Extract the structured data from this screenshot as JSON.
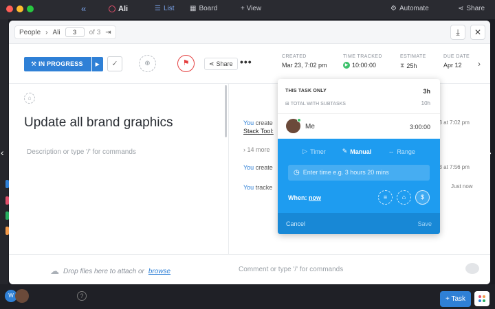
{
  "app": {
    "list_name": "Ali",
    "view_list": "List",
    "view_board": "Board",
    "add_view": "+ View",
    "automate": "Automate",
    "share": "Share",
    "task_button": "+ Task",
    "help": "?"
  },
  "breadcrumb": {
    "space": "People",
    "item": "Ali",
    "page": "3",
    "of": "of 3"
  },
  "task": {
    "status": "IN PROGRESS",
    "share": "Share",
    "created_label": "CREATED",
    "created_value": "Mar 23, 7:02 pm",
    "tracked_label": "TIME TRACKED",
    "tracked_value": "10:00:00",
    "estimate_label": "ESTIMATE",
    "estimate_value": "25h",
    "due_label": "DUE DATE",
    "due_value": "Apr 12",
    "title": "Update all brand graphics",
    "description_placeholder": "Description or type '/' for commands"
  },
  "activity": {
    "you": "You",
    "row1": "create",
    "row1_time": "23 at 7:02 pm",
    "row1_sub": "Stack Tool:",
    "more": "14 more",
    "row2": "create",
    "row2_time": "23 at 7:56 pm",
    "row3": "tracke",
    "row3_time": "Just now"
  },
  "bottom": {
    "drop_text": "Drop files here to attach or",
    "browse": "browse",
    "comment_placeholder": "Comment or type '/' for commands"
  },
  "time_popup": {
    "this_task_only": "THIS TASK ONLY",
    "this_task_value": "3h",
    "total_with_subtasks": "TOTAL WITH SUBTASKS",
    "total_value": "10h",
    "user_name": "Me",
    "user_time": "3:00:00",
    "tab_timer": "Timer",
    "tab_manual": "Manual",
    "tab_range": "Range",
    "input_placeholder": "Enter time e.g. 3 hours 20 mins",
    "when_label": "When:",
    "when_value": "now",
    "cancel": "Cancel",
    "save": "Save"
  },
  "colors": {
    "accent": "#2f80d6",
    "popup_blue": "#1e9cf0",
    "flag_red": "#e43f3f",
    "tracked_green": "#3cc16b"
  }
}
